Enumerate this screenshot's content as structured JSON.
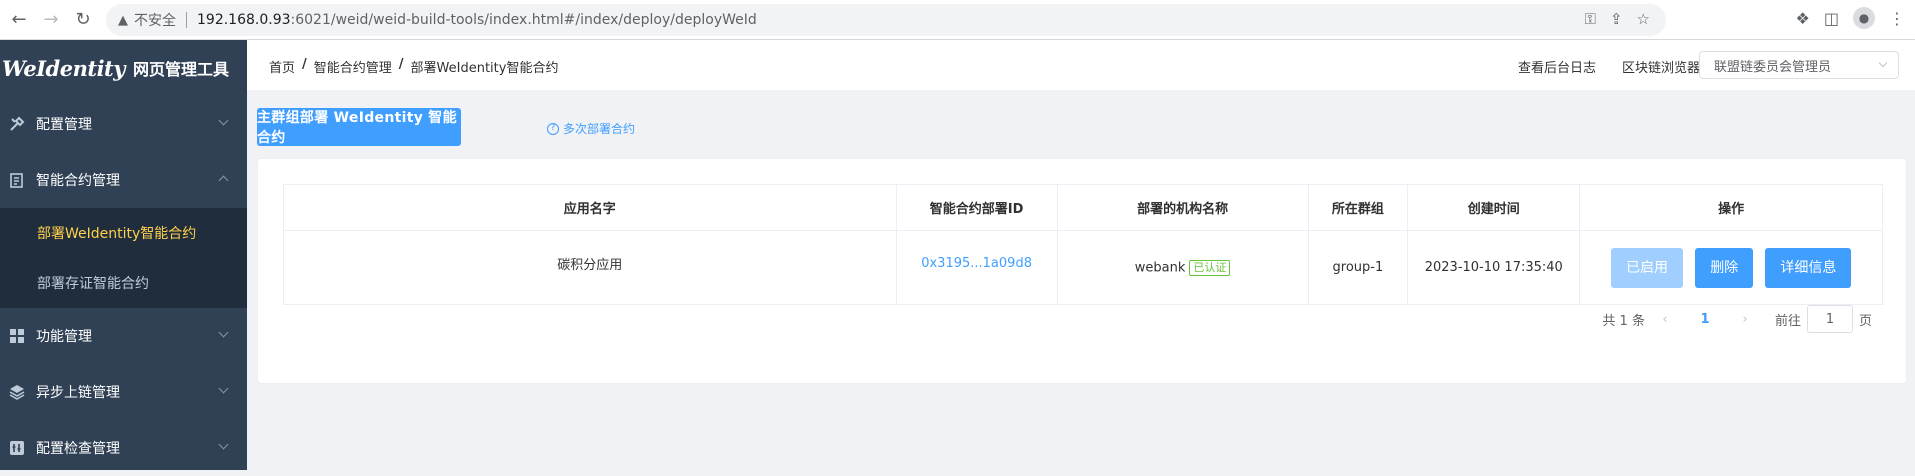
{
  "browser": {
    "insecure_label": "不安全",
    "url_host": "192.168.0.93",
    "url_path": ":6021/weid/weid-build-tools/index.html#/index/deploy/deployWeId"
  },
  "sidebar": {
    "logo_mark": "WeIdentity",
    "logo_text": "网页管理工具",
    "items": [
      {
        "label": "配置管理",
        "icon": "tools-icon"
      },
      {
        "label": "智能合约管理",
        "icon": "contract-icon",
        "expanded": true,
        "children": [
          {
            "label": "部署WeIdentity智能合约",
            "active": true
          },
          {
            "label": "部署存证智能合约",
            "active": false
          }
        ]
      },
      {
        "label": "功能管理",
        "icon": "grid-icon"
      },
      {
        "label": "异步上链管理",
        "icon": "layers-icon"
      },
      {
        "label": "配置检查管理",
        "icon": "check-icon"
      }
    ]
  },
  "header": {
    "breadcrumb": [
      "首页",
      "智能合约管理",
      "部署WeIdentity智能合约"
    ],
    "links": [
      "查看后台日志",
      "区块链浏览器"
    ],
    "role_select": "联盟链委员会管理员"
  },
  "main": {
    "deploy_button": "主群组部署 WeIdentity 智能合约",
    "multi_deploy_link": "多次部署合约",
    "table": {
      "columns": [
        "应用名字",
        "智能合约部署ID",
        "部署的机构名称",
        "所在群组",
        "创建时间",
        "操作"
      ],
      "rows": [
        {
          "app_name": "碳积分应用",
          "deploy_id": "0x3195...1a09d8",
          "org_name": "webank",
          "org_tag": "已认证",
          "group": "group-1",
          "created": "2023-10-10 17:35:40",
          "actions": [
            "已启用",
            "删除",
            "详细信息"
          ]
        }
      ]
    },
    "pagination": {
      "total_text": "共 1 条",
      "current_page": "1",
      "goto_label": "前往",
      "goto_value": "1",
      "page_suffix": "页"
    }
  }
}
